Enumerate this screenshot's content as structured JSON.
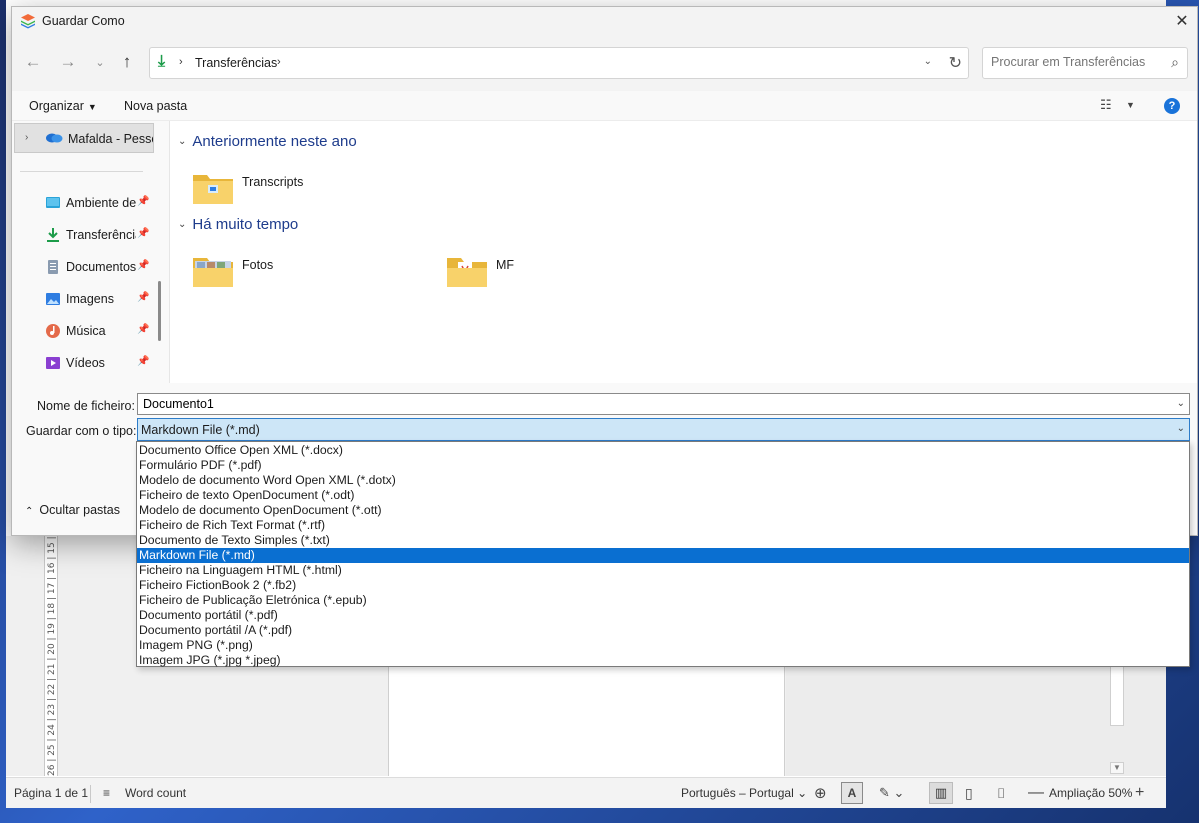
{
  "dialog": {
    "title": "Guardar Como",
    "close": "✕"
  },
  "nav": {
    "back": "←",
    "forward": "→",
    "recent": "⌄",
    "up": "↑",
    "address": "Transferências",
    "search_placeholder": "Procurar em Transferências"
  },
  "toolbar": {
    "organize": "Organizar",
    "new_folder": "Nova pasta",
    "help": "?"
  },
  "sidebar": {
    "onedrive": "Mafalda - Pessoal",
    "items": [
      {
        "label": "Ambiente de trabalho",
        "icon": "desktop-icon"
      },
      {
        "label": "Transferências",
        "icon": "download-icon"
      },
      {
        "label": "Documentos",
        "icon": "document-icon"
      },
      {
        "label": "Imagens",
        "icon": "image-icon"
      },
      {
        "label": "Música",
        "icon": "music-icon"
      },
      {
        "label": "Vídeos",
        "icon": "video-icon"
      }
    ]
  },
  "content": {
    "groups": [
      {
        "title": "Anteriormente neste ano",
        "folders": [
          "Transcripts"
        ]
      },
      {
        "title": "Há muito tempo",
        "folders": [
          "Fotos",
          "MF"
        ]
      }
    ]
  },
  "form": {
    "filename_label": "Nome de ficheiro:",
    "filename_value": "Documento1",
    "type_label": "Guardar com o tipo:",
    "type_value": "Markdown File (*.md)",
    "hide_folders": "Ocultar pastas"
  },
  "type_options": [
    "Documento Office Open XML (*.docx)",
    "Formulário PDF (*.pdf)",
    "Modelo de documento Word Open XML (*.dotx)",
    "Ficheiro de texto OpenDocument (*.odt)",
    "Modelo de documento OpenDocument (*.ott)",
    "Ficheiro de Rich Text Format (*.rtf)",
    "Documento de Texto Simples (*.txt)",
    "Markdown File (*.md)",
    "Ficheiro na Linguagem HTML (*.html)",
    "Ficheiro FictionBook 2 (*.fb2)",
    "Ficheiro de Publicação Eletrónica (*.epub)",
    "Documento portátil (*.pdf)",
    "Documento portátil /A (*.pdf)",
    "Imagem PNG (*.png)",
    "Imagem JPG (*.jpg *.jpeg)"
  ],
  "selected_option_index": 7,
  "ruler": {
    "text": "26 | 25 | 24 | 23 | 22 | 21 | 20 | 19 | 18 | 17 | 16 | 15 | 14"
  },
  "statusbar": {
    "page": "Página 1 de 1",
    "word_count": "Word count",
    "language": "Português – Portugal ⌄",
    "zoom": "Ampliação 50%"
  },
  "colors": {
    "accent": "#0a6fd1",
    "group_header": "#1e3c8c",
    "selection_bg": "#cde6f7"
  }
}
